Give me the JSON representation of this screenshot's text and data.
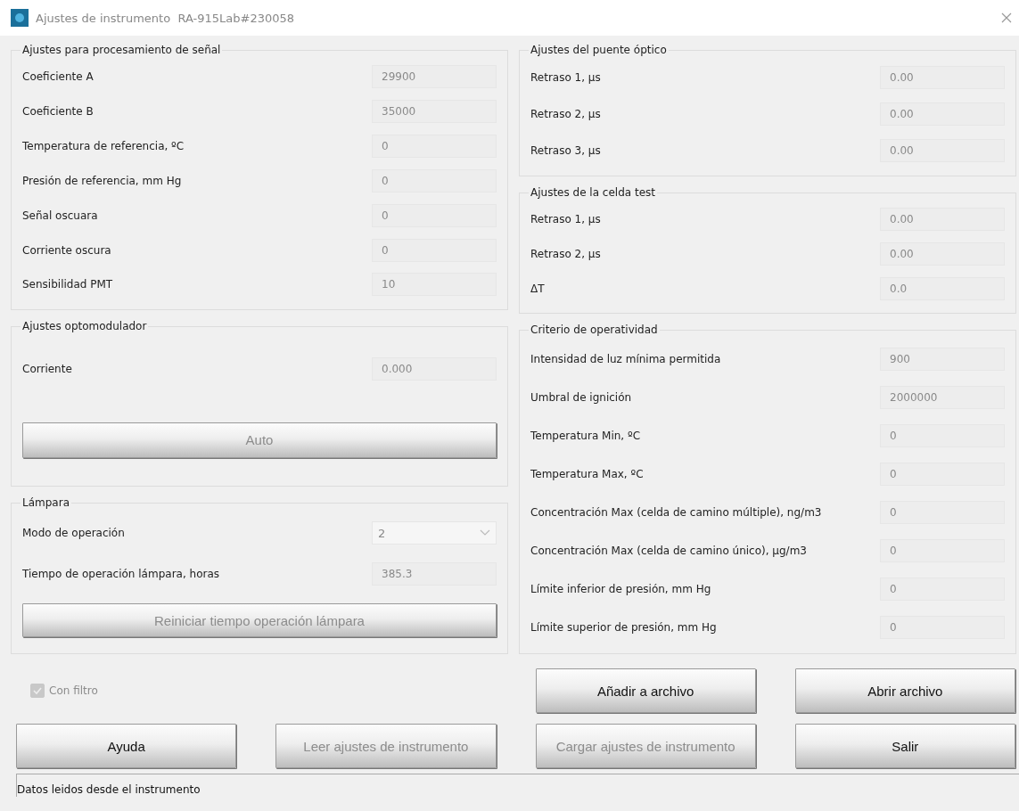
{
  "window": {
    "title": "Ajustes de instrumento  RA-915Lab#230058"
  },
  "left_groups": [
    {
      "title": "Ajustes para procesamiento de señal",
      "rows": [
        {
          "kind": "field",
          "label": "Coeficiente A",
          "value": "29900"
        },
        {
          "kind": "field",
          "label": "Coeficiente B",
          "value": "35000"
        },
        {
          "kind": "field",
          "label": "Temperatura de referencia, ºC",
          "value": "0"
        },
        {
          "kind": "field",
          "label": "Presión de referencia, mm Hg",
          "value": "0"
        },
        {
          "kind": "field",
          "label": "Señal oscuara",
          "value": "0"
        },
        {
          "kind": "field",
          "label": "Corriente oscura",
          "value": "0"
        },
        {
          "kind": "field",
          "label": "Sensibilidad PMT",
          "value": "10"
        }
      ]
    },
    {
      "title": "Ajustes optomodulador",
      "rows": [
        {
          "kind": "field",
          "label": "Corriente",
          "value": "0.000"
        },
        {
          "kind": "button",
          "label": "Auto",
          "disabled": true
        }
      ]
    },
    {
      "title": "Lámpara",
      "rows": [
        {
          "kind": "select",
          "label": "Modo de operación",
          "value": "2"
        },
        {
          "kind": "field",
          "label": "Tiempo de operación lámpara, horas",
          "value": "385.3"
        },
        {
          "kind": "button",
          "label": "Reiniciar tiempo operación lámpara",
          "disabled": true
        }
      ]
    }
  ],
  "right_groups": [
    {
      "title": "Ajustes del puente óptico",
      "rows": [
        {
          "kind": "field",
          "label": "Retraso 1, µs",
          "value": "0.00"
        },
        {
          "kind": "field",
          "label": "Retraso 2, µs",
          "value": "0.00"
        },
        {
          "kind": "field",
          "label": "Retraso 3, µs",
          "value": "0.00"
        }
      ]
    },
    {
      "title": "Ajustes de la celda test",
      "rows": [
        {
          "kind": "field",
          "label": "Retraso 1, µs",
          "value": "0.00"
        },
        {
          "kind": "field",
          "label": "Retraso 2, µs",
          "value": "0.00"
        },
        {
          "kind": "field",
          "label": "ΔT",
          "value": "0.0"
        }
      ]
    },
    {
      "title": "Criterio de operatividad",
      "rows": [
        {
          "kind": "field",
          "label": "Intensidad de luz mínima permitida",
          "value": "900"
        },
        {
          "kind": "field",
          "label": "Umbral de ignición",
          "value": "2000000"
        },
        {
          "kind": "field",
          "label": "Temperatura Min, ºC",
          "value": "0"
        },
        {
          "kind": "field",
          "label": "Temperatura Max, ºC",
          "value": "0"
        },
        {
          "kind": "field",
          "label": "Concentración Max (celda de camino múltiple), ng/m3",
          "value": "0"
        },
        {
          "kind": "field",
          "label": "Concentración Max (celda de camino único), µg/m3",
          "value": "0"
        },
        {
          "kind": "field",
          "label": "Límite inferior de presión, mm Hg",
          "value": "0"
        },
        {
          "kind": "field",
          "label": "Límite superior de presión, mm Hg",
          "value": "0"
        }
      ]
    }
  ],
  "filter_checkbox": {
    "label": "Con filtro",
    "checked": true,
    "disabled": true
  },
  "actions": [
    {
      "label": "Añadir a archivo",
      "disabled": false
    },
    {
      "label": "Abrir archivo",
      "disabled": false
    },
    {
      "label": "Ayuda",
      "disabled": false
    },
    {
      "label": "Leer ajustes de instrumento",
      "disabled": true
    },
    {
      "label": "Cargar ajustes de instrumento",
      "disabled": true
    },
    {
      "label": "Salir",
      "disabled": false
    }
  ],
  "status_bar": {
    "text": "Datos leidos desde el instrumento"
  }
}
